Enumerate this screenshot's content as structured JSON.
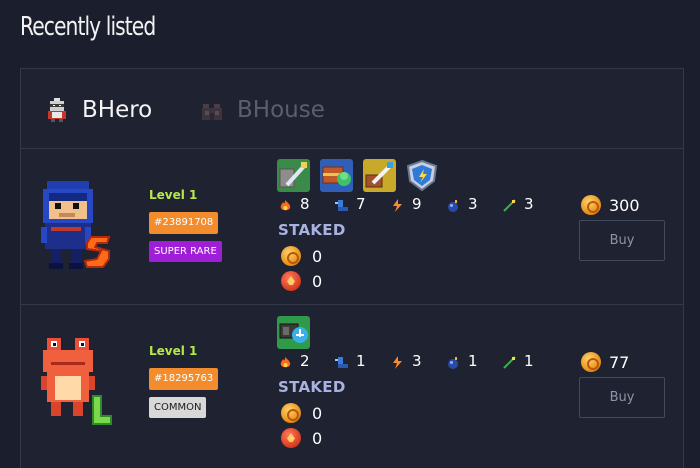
{
  "page": {
    "title": "Recently listed"
  },
  "tabs": [
    {
      "label": "BHero",
      "icon": "hero-helmet-icon",
      "active": true
    },
    {
      "label": "BHouse",
      "icon": "house-icon",
      "active": false
    }
  ],
  "listings": [
    {
      "avatar": "ninja-hero-sprite",
      "level": "Level 1",
      "id": "#23891708",
      "rarity": "SUPER RARE",
      "skills": [
        "pierce-block-skill-icon",
        "treasure-hunter-skill-icon",
        "pierce-chest-skill-icon",
        "shield-skill-icon"
      ],
      "stats": [
        "8",
        "7",
        "9",
        "3",
        "3"
      ],
      "staked_label": "STAKED",
      "staked": [
        "0",
        "0"
      ],
      "price": "300",
      "buy_label": "Buy"
    },
    {
      "avatar": "frog-hero-sprite",
      "level": "Level 1",
      "id": "#18295763",
      "rarity": "COMMON",
      "skills": [
        "save-battery-skill-icon"
      ],
      "stats": [
        "2",
        "1",
        "3",
        "1",
        "1"
      ],
      "staked_label": "STAKED",
      "staked": [
        "0",
        "0"
      ],
      "price": "77",
      "buy_label": "Buy"
    }
  ],
  "stat_icons": [
    "power-flame-icon",
    "speed-boot-icon",
    "stamina-icon",
    "bomb-icon",
    "range-icon"
  ],
  "colors": {
    "background": "#1b1e2c",
    "level": "#b6e84a",
    "id_badge": "#f28c2c",
    "super_rare": "#a11ed8",
    "common": "#d8d8d8",
    "staked": "#a9b3e0"
  }
}
